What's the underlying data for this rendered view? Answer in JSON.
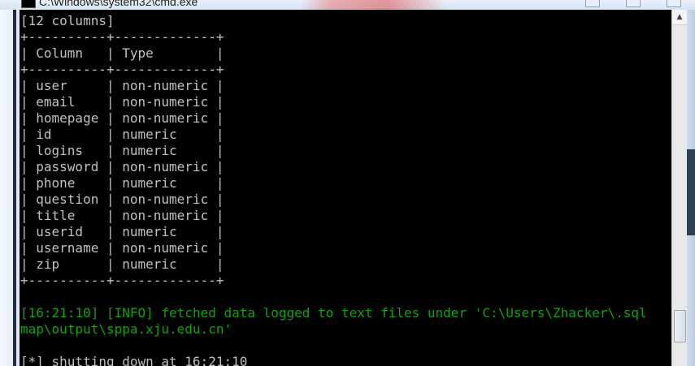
{
  "window": {
    "title": "C:\\Windows\\system32\\cmd.exe"
  },
  "console": {
    "lines": [
      {
        "text": "[12 columns]",
        "color": "gray"
      },
      {
        "text": "+----------+-------------+",
        "color": "gray"
      },
      {
        "text": "| Column   | Type        |",
        "color": "gray"
      },
      {
        "text": "+----------+-------------+",
        "color": "gray"
      },
      {
        "text": "| user     | non-numeric |",
        "color": "gray"
      },
      {
        "text": "| email    | non-numeric |",
        "color": "gray"
      },
      {
        "text": "| homepage | non-numeric |",
        "color": "gray"
      },
      {
        "text": "| id       | numeric     |",
        "color": "gray"
      },
      {
        "text": "| logins   | numeric     |",
        "color": "gray"
      },
      {
        "text": "| password | non-numeric |",
        "color": "gray"
      },
      {
        "text": "| phone    | numeric     |",
        "color": "gray"
      },
      {
        "text": "| question | non-numeric |",
        "color": "gray"
      },
      {
        "text": "| title    | non-numeric |",
        "color": "gray"
      },
      {
        "text": "| userid   | numeric     |",
        "color": "gray"
      },
      {
        "text": "| username | non-numeric |",
        "color": "gray"
      },
      {
        "text": "| zip      | numeric     |",
        "color": "gray"
      },
      {
        "text": "+----------+-------------+",
        "color": "gray"
      },
      {
        "text": "",
        "color": "gray"
      },
      {
        "text": "[16:21:10] [INFO] fetched data logged to text files under 'C:\\Users\\Zhacker\\.sql",
        "color": "green"
      },
      {
        "text": "map\\output\\sppa.xju.edu.cn'",
        "color": "green"
      },
      {
        "text": "",
        "color": "gray"
      },
      {
        "text": "[*] shutting down at 16:21:10",
        "color": "gray"
      }
    ]
  },
  "colors": {
    "background": "#000000",
    "default_text": "#c0c0c0",
    "info_text": "#13a10e"
  },
  "icons": {
    "window_icon": "cmd-icon",
    "scroll_up": "scroll-up-arrow-icon"
  }
}
